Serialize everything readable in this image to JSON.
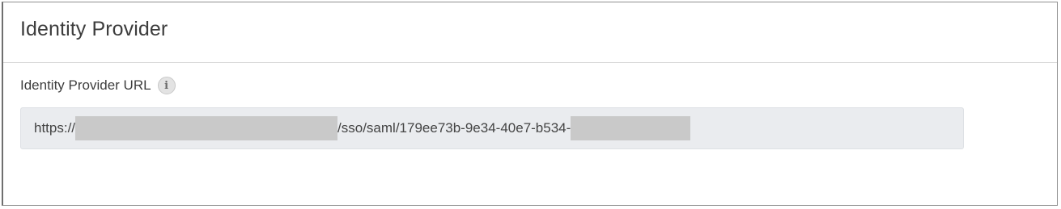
{
  "section": {
    "title": "Identity Provider"
  },
  "field": {
    "label": "Identity Provider URL",
    "info_icon": "info-icon",
    "value_prefix": "https://",
    "value_middle": "/sso/saml/179ee73b-9e34-40e7-b534-"
  },
  "colors": {
    "field_background": "#eaecef",
    "redaction": "#c9c9c9",
    "panel_border": "#8f8f8f"
  }
}
